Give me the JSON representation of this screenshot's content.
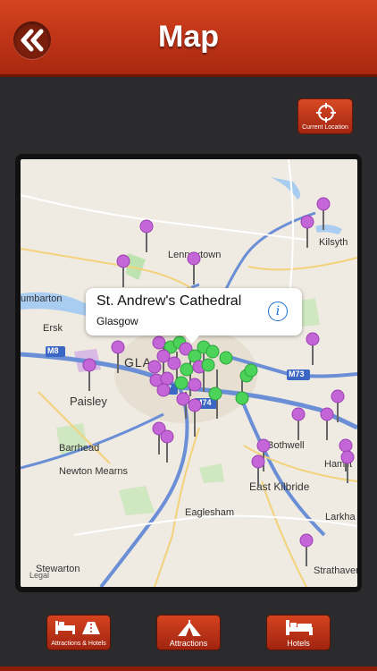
{
  "header": {
    "title": "Map"
  },
  "current_location": {
    "label": "Current Location"
  },
  "map": {
    "places": {
      "dumbarton": "umbarton",
      "lennoxtown": "Lennoxtown",
      "kilsyth": "Kilsyth",
      "ersk": "Ersk",
      "glas": "GLA",
      "paisley": "Paisley",
      "barrhead": "Barrhead",
      "bothwell": "Bothwell",
      "newton_mearns": "Newton Mearns",
      "east_kilbride": "East Kilbride",
      "hamilt": "Hamilt",
      "larkha": "Larkha",
      "eaglesham": "Eaglesham",
      "stewarton": "Stewarton",
      "strathaven": "Strathaven"
    },
    "roads": {
      "m8": "M8",
      "m73": "M73",
      "m74": "M74",
      "m7": "7"
    },
    "legal": "Legal"
  },
  "callout": {
    "title": "St. Andrew's Cathedral",
    "subtitle": "Glasgow",
    "info_glyph": "i"
  },
  "tabs": {
    "attractions_hotels": "Attractions & Hotels",
    "attractions": "Attractions",
    "hotels": "Hotels"
  },
  "colors": {
    "brand": "#c7361a",
    "pin_purple": "#c566d8",
    "pin_green": "#4bd35a"
  }
}
